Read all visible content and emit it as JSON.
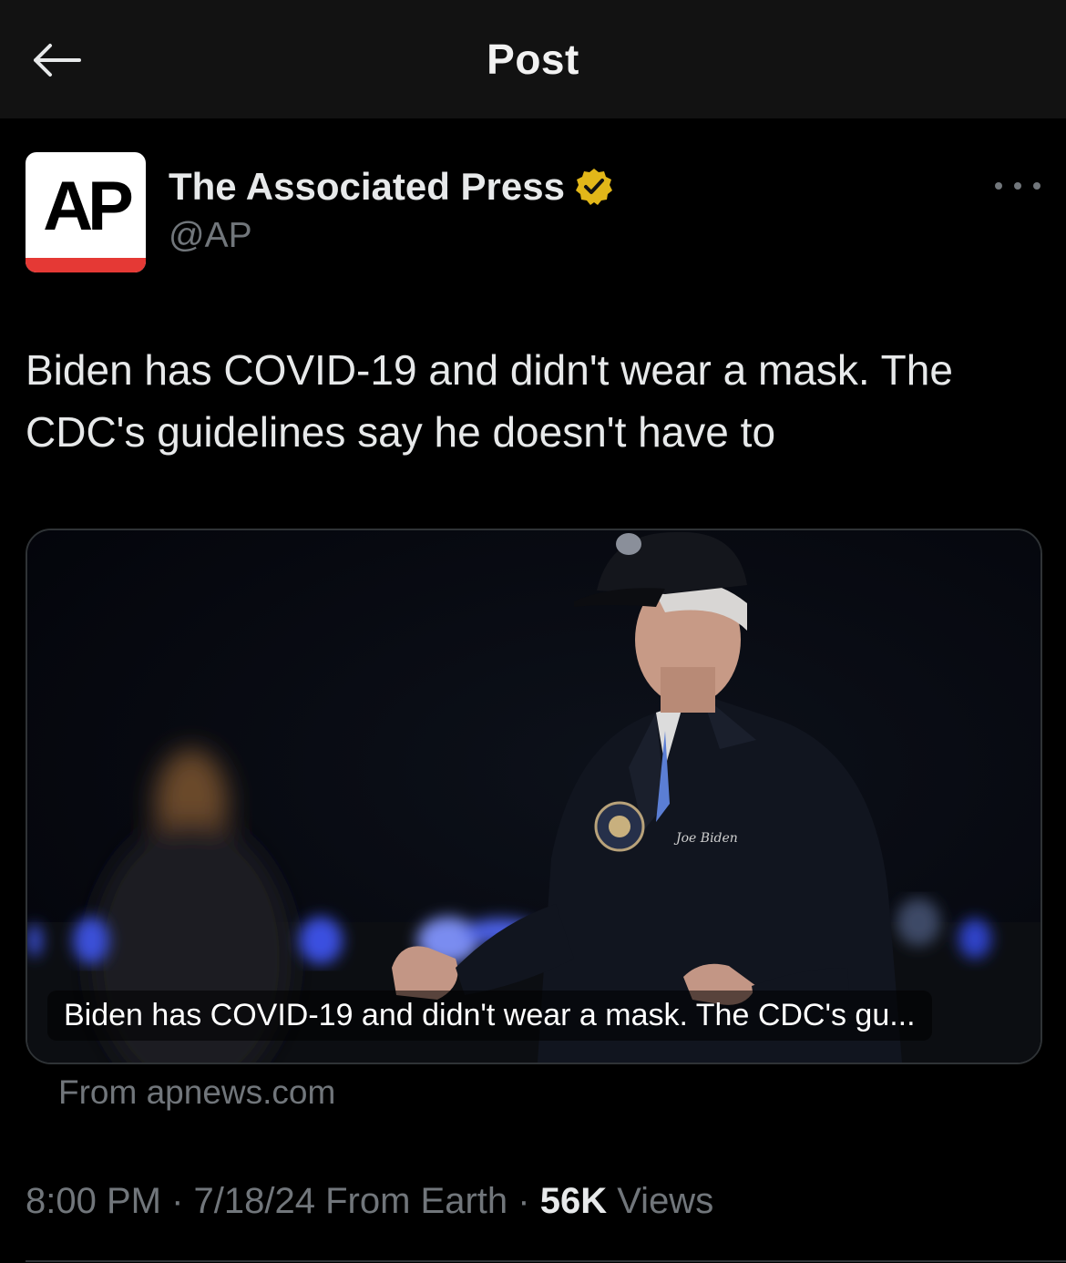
{
  "header": {
    "title": "Post"
  },
  "author": {
    "name": "The Associated Press",
    "handle": "@AP",
    "avatar_text": "AP",
    "verified_color": "#e2b719"
  },
  "post": {
    "text": "Biden has COVID-19 and didn't wear a mask. The CDC's guidelines say he doesn't have to"
  },
  "link_card": {
    "caption": "Biden has COVID-19 and didn't wear a mask. The CDC's gu...",
    "source": "From apnews.com",
    "image_jacket_text": "Joe Biden"
  },
  "meta": {
    "time": "8:00 PM",
    "sep1": " · ",
    "date": "7/18/24",
    "location": "From Earth",
    "sep2": " · ",
    "views_count": "56K",
    "views_label": "Views"
  },
  "colors": {
    "background": "#000000",
    "topbar": "#121212",
    "text_primary": "#e7e9ea",
    "text_secondary": "#71767b",
    "ap_red": "#e53935"
  }
}
